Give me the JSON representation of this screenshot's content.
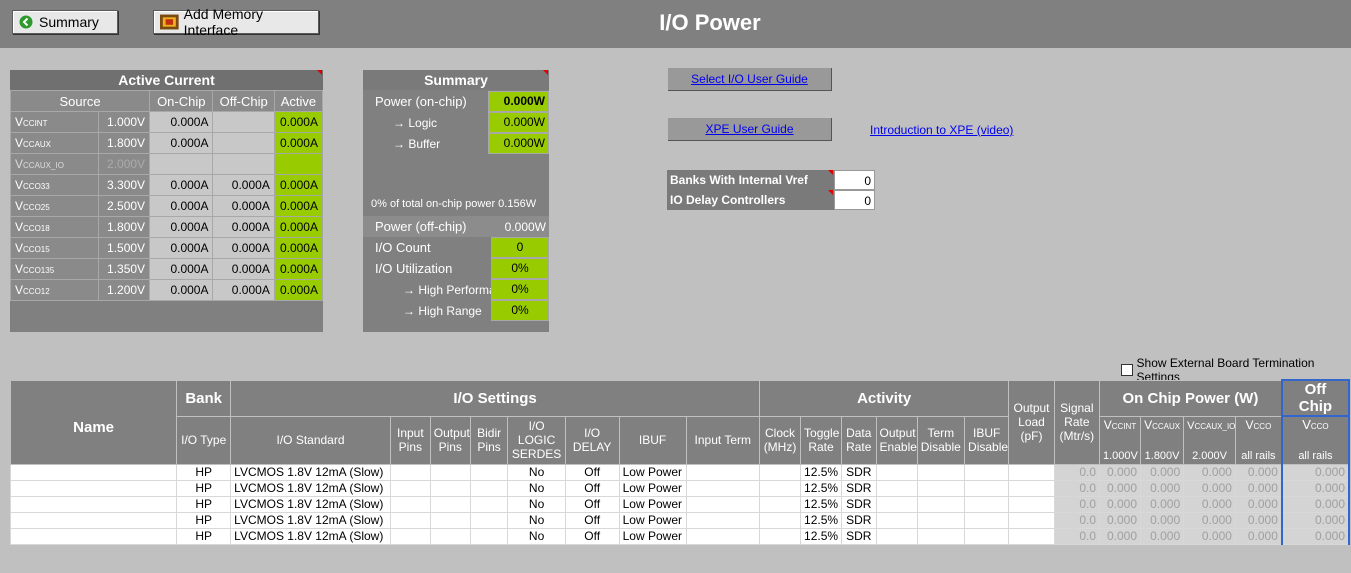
{
  "toolbar": {
    "summary_label": "Summary",
    "add_memory_label": "Add Memory Interface"
  },
  "page_title": "I/O Power",
  "active_current": {
    "title": "Active Current",
    "headers": [
      "Source",
      "On-Chip",
      "Off-Chip",
      "Active"
    ],
    "rows": [
      {
        "name": "V",
        "sub": "CCINT",
        "volt": "1.000V",
        "on": "0.000A",
        "off": "",
        "active": "0.000A"
      },
      {
        "name": "V",
        "sub": "CCAUX",
        "volt": "1.800V",
        "on": "0.000A",
        "off": "",
        "active": "0.000A"
      },
      {
        "name": "V",
        "sub": "CCAUX_IO",
        "volt": "2.000V",
        "on": "",
        "off": "",
        "active": ""
      },
      {
        "name": "V",
        "sub": "CCO33",
        "volt": "3.300V",
        "on": "0.000A",
        "off": "0.000A",
        "active": "0.000A"
      },
      {
        "name": "V",
        "sub": "CCO25",
        "volt": "2.500V",
        "on": "0.000A",
        "off": "0.000A",
        "active": "0.000A"
      },
      {
        "name": "V",
        "sub": "CCO18",
        "volt": "1.800V",
        "on": "0.000A",
        "off": "0.000A",
        "active": "0.000A"
      },
      {
        "name": "V",
        "sub": "CCO15",
        "volt": "1.500V",
        "on": "0.000A",
        "off": "0.000A",
        "active": "0.000A"
      },
      {
        "name": "V",
        "sub": "CCO135",
        "volt": "1.350V",
        "on": "0.000A",
        "off": "0.000A",
        "active": "0.000A"
      },
      {
        "name": "V",
        "sub": "CCO12",
        "volt": "1.200V",
        "on": "0.000A",
        "off": "0.000A",
        "active": "0.000A"
      }
    ]
  },
  "summary": {
    "title": "Summary",
    "power_on_chip_label": "Power (on-chip)",
    "power_on_chip": "0.000W",
    "logic_label": "Logic",
    "logic": "0.000W",
    "buffer_label": "Buffer",
    "buffer": "0.000W",
    "pct_note": "0% of total on-chip power 0.156W",
    "power_off_chip_label": "Power (off-chip)",
    "power_off_chip": "0.000W",
    "io_count_label": "I/O Count",
    "io_count": "0",
    "io_util_label": "I/O Utilization",
    "io_util": "0%",
    "high_perf_label": "High Performanc",
    "high_perf": "0%",
    "high_range_label": "High Range",
    "high_range": "0%"
  },
  "links": {
    "select_io": "Select I/O User Guide",
    "xpe_guide": "XPE User Guide",
    "intro_video": "Introduction to XPE (video)"
  },
  "settings": {
    "banks_label": "Banks With Internal Vref",
    "banks_value": "0",
    "iodelay_label": "IO Delay Controllers",
    "iodelay_value": "0"
  },
  "show_ext_label": "Show External Board Termination Settings",
  "io_table": {
    "groups": {
      "name": "Name",
      "bank": "Bank",
      "io_settings": "I/O Settings",
      "activity": "Activity",
      "output_load": "Output Load (pF)",
      "signal_rate": "Signal Rate (Mtr/s)",
      "on_chip_power": "On Chip Power (W)",
      "off_chip": "Off Chip"
    },
    "sub_headers": {
      "io_type": "I/O Type",
      "io_standard": "I/O Standard",
      "input_pins": "Input Pins",
      "output_pins": "Output Pins",
      "bidir_pins": "Bidir Pins",
      "logic_serdes": "I/O LOGIC SERDES",
      "io_delay": "I/O DELAY",
      "ibuf": "IBUF",
      "input_term": "Input Term",
      "clock": "Clock (MHz)",
      "toggle": "Toggle Rate",
      "data_rate": "Data Rate",
      "output_enable": "Output Enable",
      "term_disable": "Term Disable",
      "ibuf_disable": "IBUF Disable",
      "output_load": "Output",
      "output_load_b": "Load",
      "output_load_c": "(pF)",
      "signal_rate": "Signal",
      "signal_rate_b": "Rate",
      "signal_rate_c": "(Mtr/s)",
      "vccint": "CCINT",
      "vccaux": "CCAUX",
      "vccaux_io": "CCAUX_IO",
      "vcco": "CCO",
      "vcco_off": "CCO",
      "vccint_v": "1.000V",
      "vccaux_v": "1.800V",
      "vccaux_io_v": "2.000V",
      "vcco_all": "all rails",
      "vcco_off_all": "all rails"
    },
    "rows": [
      {
        "type": "HP",
        "standard": "LVCMOS 1.8V 12mA (Slow)",
        "serdes": "No",
        "delay": "Off",
        "ibuf": "Low Power",
        "toggle": "12.5%",
        "rate": "SDR",
        "sig": "0.0",
        "p1": "0.000",
        "p2": "0.000",
        "p3": "0.000",
        "p4": "0.000",
        "p5": "0.000"
      },
      {
        "type": "HP",
        "standard": "LVCMOS 1.8V 12mA (Slow)",
        "serdes": "No",
        "delay": "Off",
        "ibuf": "Low Power",
        "toggle": "12.5%",
        "rate": "SDR",
        "sig": "0.0",
        "p1": "0.000",
        "p2": "0.000",
        "p3": "0.000",
        "p4": "0.000",
        "p5": "0.000"
      },
      {
        "type": "HP",
        "standard": "LVCMOS 1.8V 12mA (Slow)",
        "serdes": "No",
        "delay": "Off",
        "ibuf": "Low Power",
        "toggle": "12.5%",
        "rate": "SDR",
        "sig": "0.0",
        "p1": "0.000",
        "p2": "0.000",
        "p3": "0.000",
        "p4": "0.000",
        "p5": "0.000"
      },
      {
        "type": "HP",
        "standard": "LVCMOS 1.8V 12mA (Slow)",
        "serdes": "No",
        "delay": "Off",
        "ibuf": "Low Power",
        "toggle": "12.5%",
        "rate": "SDR",
        "sig": "0.0",
        "p1": "0.000",
        "p2": "0.000",
        "p3": "0.000",
        "p4": "0.000",
        "p5": "0.000"
      },
      {
        "type": "HP",
        "standard": "LVCMOS 1.8V 12mA (Slow)",
        "serdes": "No",
        "delay": "Off",
        "ibuf": "Low Power",
        "toggle": "12.5%",
        "rate": "SDR",
        "sig": "0.0",
        "p1": "0.000",
        "p2": "0.000",
        "p3": "0.000",
        "p4": "0.000",
        "p5": "0.000"
      }
    ]
  }
}
